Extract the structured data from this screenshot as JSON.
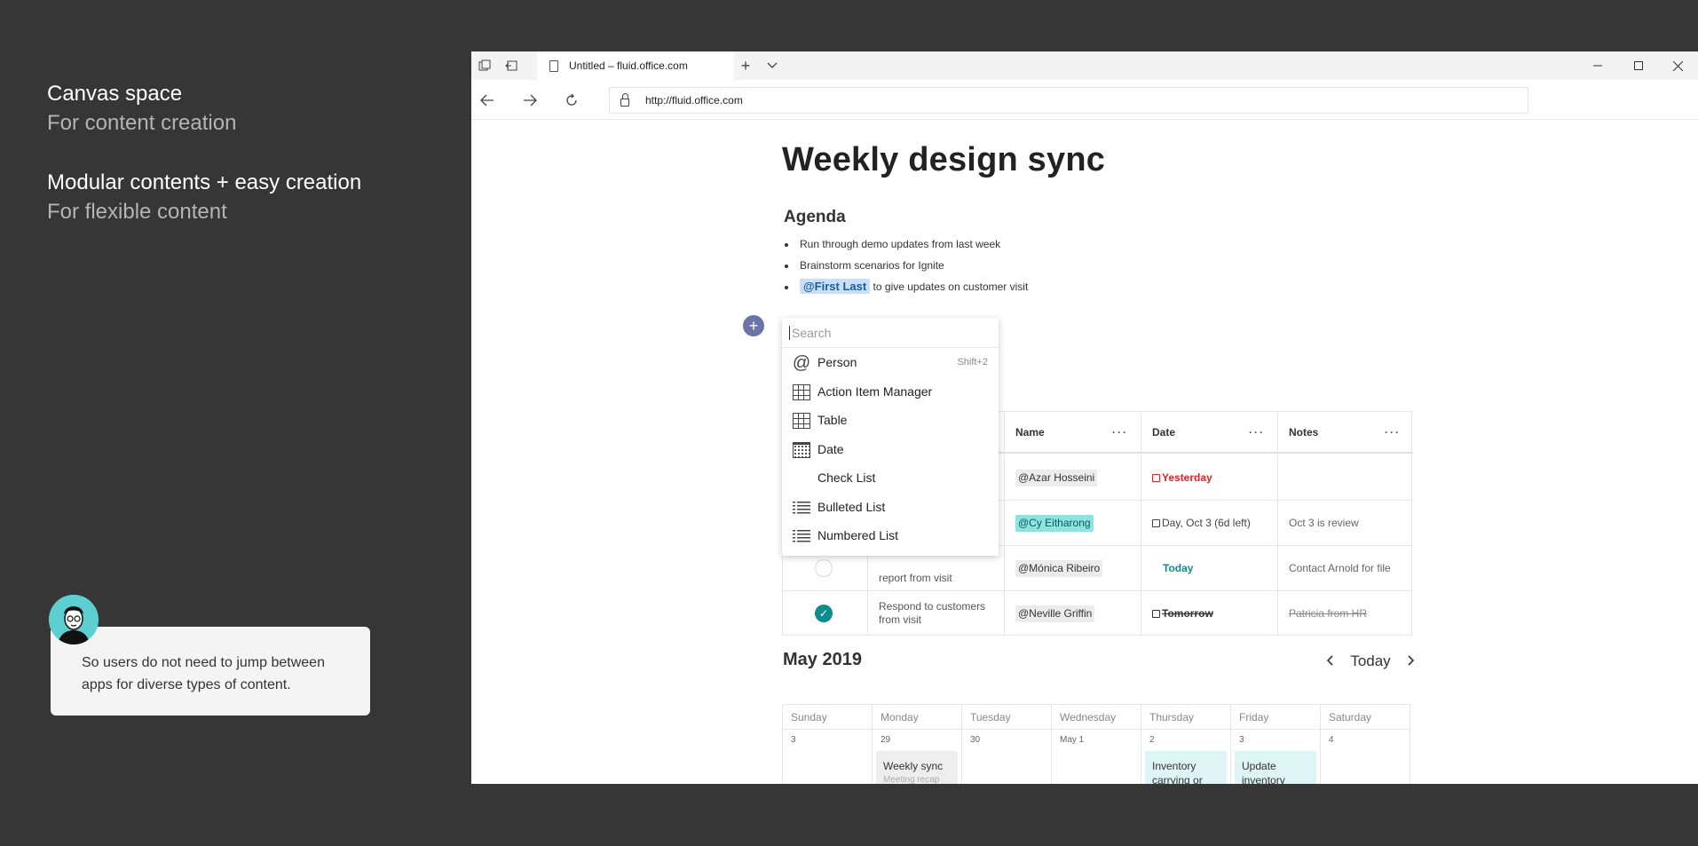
{
  "captions": [
    {
      "heading": "Canvas space",
      "sub": "For content creation"
    },
    {
      "heading": "Modular contents + easy creation",
      "sub": "For flexible content"
    }
  ],
  "comment": {
    "text": "So users do not need to jump between apps for diverse types of content."
  },
  "browser": {
    "tab_title": "Untitled – fluid.office.com",
    "url": "http://fluid.office.com"
  },
  "doc": {
    "title": "Weekly design sync",
    "agenda_heading": "Agenda",
    "agenda": [
      {
        "text": "Run through demo updates from last week"
      },
      {
        "text": "Brainstorm scenarios for Ignite"
      },
      {
        "mention": "@First Last",
        "text": "to give updates on customer visit"
      }
    ]
  },
  "menu": {
    "search_placeholder": "Search",
    "items": [
      {
        "label": "Person",
        "icon": "at-icon",
        "shortcut": "Shift+2"
      },
      {
        "label": "Action Item Manager",
        "icon": "grid-icon"
      },
      {
        "label": "Table",
        "icon": "grid-icon"
      },
      {
        "label": "Date",
        "icon": "calendar-icon"
      },
      {
        "label": "Check List",
        "icon": ""
      },
      {
        "label": "Bulleted List",
        "icon": "bulleted-list-icon"
      },
      {
        "label": "Numbered List",
        "icon": "numbered-list-icon"
      }
    ]
  },
  "table": {
    "headers": [
      "Name",
      "Date",
      "Notes"
    ],
    "rows": [
      {
        "task": "",
        "name": "@Azar Hosseini",
        "date": "Yesterday",
        "notes": "",
        "done": false
      },
      {
        "task": "",
        "name": "@Cy Eitharong",
        "date": "Day, Oct 3 (6d left)",
        "notes": "Oct 3 is review",
        "done": false
      },
      {
        "task": "report from visit",
        "name": "@Mónica Ribeiro",
        "date": "Today",
        "notes": "Contact Arnold for file",
        "done": false
      },
      {
        "task": "Respond to customers from visit",
        "name": "@Neville Griffin",
        "date": "Tomorrow",
        "notes": "Patricia from HR",
        "done": true
      }
    ]
  },
  "calendar": {
    "title": "May 2019",
    "today_label": "Today",
    "days": [
      "Sunday",
      "Monday",
      "Tuesday",
      "Wednesday",
      "Thursday",
      "Friday",
      "Saturday"
    ],
    "dates": [
      "3",
      "29",
      "30",
      "May 1",
      "2",
      "3",
      "4"
    ],
    "events": {
      "monday": {
        "title": "Weekly sync",
        "sub": "Meeting recap"
      },
      "thursday": {
        "title": "Inventory carrying or"
      },
      "friday": {
        "title": "Update inventory"
      }
    }
  },
  "colors": {
    "accent": "#0f8c8c",
    "mention_bg": "#c9dff4",
    "danger": "#e0242a",
    "plus_btn": "#6c73a6"
  }
}
